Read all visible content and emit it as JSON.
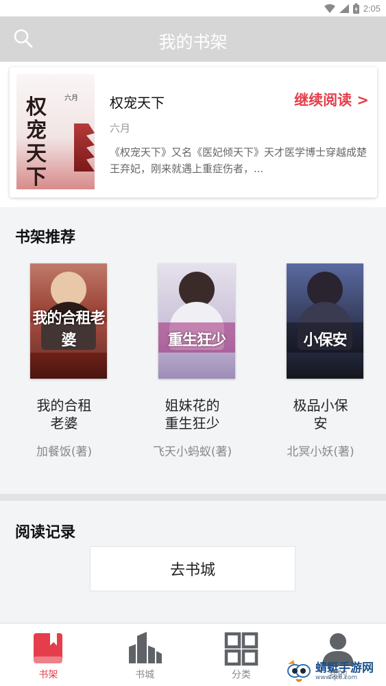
{
  "status_bar": {
    "time": "2:05",
    "icons": [
      "wifi-icon",
      "signal-icon",
      "battery-icon"
    ]
  },
  "header": {
    "title": "我的书架",
    "search_icon": "search-icon"
  },
  "recent_book": {
    "title": "权宠天下",
    "author": "六月",
    "continue_label": "继续阅读 >",
    "description": "《权宠天下》又名《医妃倾天下》天才医学博士穿越成楚王弃妃，刚来就遇上重症伤者，..."
  },
  "recommend": {
    "section_title": "书架推荐",
    "books": [
      {
        "title": "我的合租老婆",
        "author": "加餐饭(著)",
        "cover_text": "我的合租老婆",
        "cover_color": "#8a2a1e"
      },
      {
        "title": "姐妹花的重生狂少",
        "author": "飞天小蚂蚁(著)",
        "cover_text": "重生狂少",
        "cover_color": "#c8bed6"
      },
      {
        "title": "极品小保安",
        "author": "北冥小妖(著)",
        "cover_text": "小保安",
        "cover_color": "#2e3450"
      }
    ]
  },
  "history": {
    "section_title": "阅读记录",
    "goto_store_label": "去书城"
  },
  "bottom_nav": {
    "items": [
      {
        "label": "书架",
        "icon": "bookshelf-icon",
        "active": true
      },
      {
        "label": "书城",
        "icon": "store-icon",
        "active": false
      },
      {
        "label": "分类",
        "icon": "category-grid-icon",
        "active": false
      },
      {
        "label": "我的",
        "icon": "user-icon",
        "active": false
      }
    ]
  },
  "watermark": {
    "name": "蜻蜓手游网",
    "url": "www.qt6.com"
  },
  "colors": {
    "accent": "#e53d4a",
    "header_bg": "#d6d6d6",
    "page_bg": "#f3f4f6",
    "inactive_icon": "#5f6368"
  }
}
